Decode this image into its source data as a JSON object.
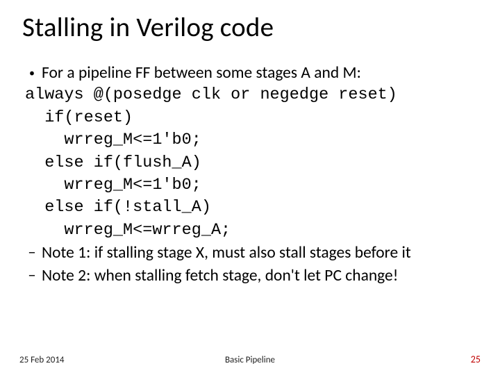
{
  "title": "Stalling in Verilog code",
  "bullet_intro": "For a pipeline FF between some stages A and M:",
  "code": {
    "l1": "always @(posedge clk or negedge reset)",
    "l2": "  if(reset)",
    "l3": "    wrreg_M<=1'b0;",
    "l4": "  else if(flush_A)",
    "l5": "    wrreg_M<=1'b0;",
    "l6": "  else if(!stall_A)",
    "l7": "    wrreg_M<=wrreg_A;"
  },
  "notes": {
    "n1": "Note 1: if stalling stage X, must also stall stages before it",
    "n2": "Note 2: when stalling fetch stage, don't let PC change!"
  },
  "footer": {
    "date": "25 Feb 2014",
    "center": "Basic Pipeline",
    "page": "25"
  }
}
